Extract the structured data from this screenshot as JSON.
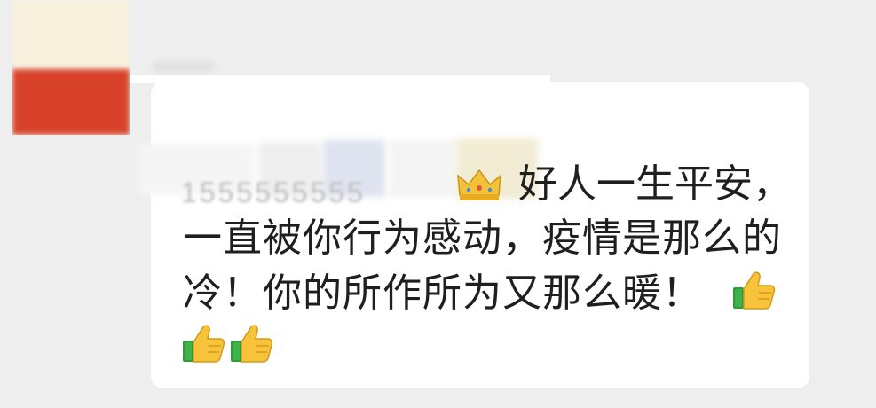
{
  "post": {
    "masked_number": "1555555555",
    "line_1": "好人一生平安，",
    "line_2": "一直被你行为感动，疫情是那么的",
    "line_3": "冷！你的所作所为又那么暖！",
    "icons": [
      "crown-icon",
      "thumbs-up-icon",
      "thumbs-up-icon",
      "thumbs-up-icon"
    ]
  }
}
